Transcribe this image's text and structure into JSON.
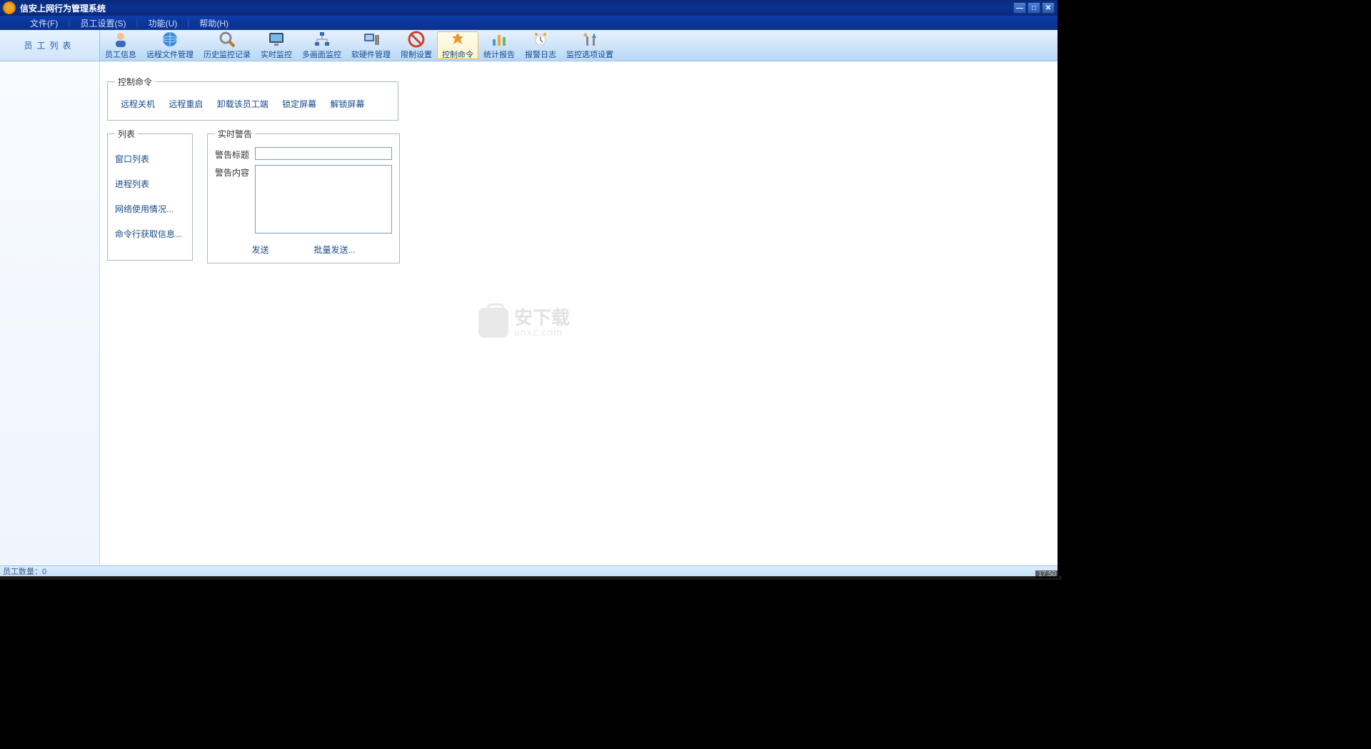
{
  "app": {
    "title": "信安上网行为管理系统"
  },
  "menu": {
    "file": "文件(F)",
    "employee": "员工设置(S)",
    "function": "功能(U)",
    "help": "帮助(H)"
  },
  "sidebar": {
    "header": "员工列表"
  },
  "toolbar": {
    "items": [
      {
        "label": "员工信息"
      },
      {
        "label": "远程文件管理"
      },
      {
        "label": "历史监控记录"
      },
      {
        "label": "实时监控"
      },
      {
        "label": "多画面监控"
      },
      {
        "label": "软硬件管理"
      },
      {
        "label": "限制设置"
      },
      {
        "label": "控制命令"
      },
      {
        "label": "统计报告"
      },
      {
        "label": "报警日志"
      },
      {
        "label": "监控选项设置"
      }
    ]
  },
  "panel": {
    "control_cmd": {
      "legend": "控制命令",
      "items": [
        "远程关机",
        "远程重启",
        "卸载该员工端",
        "锁定屏幕",
        "解锁屏幕"
      ]
    },
    "list": {
      "legend": "列表",
      "items": [
        "窗口列表",
        "进程列表",
        "网络使用情况...",
        "命令行获取信息..."
      ]
    },
    "alert": {
      "legend": "实时警告",
      "title_label": "警告标题",
      "content_label": "警告内容",
      "title_value": "",
      "content_value": "",
      "send": "发送",
      "batch_send": "批量发送..."
    }
  },
  "watermark": {
    "cn": "安下载",
    "en": "anxz.com"
  },
  "status": {
    "text": "员工数量：0"
  },
  "clock": "17:50"
}
